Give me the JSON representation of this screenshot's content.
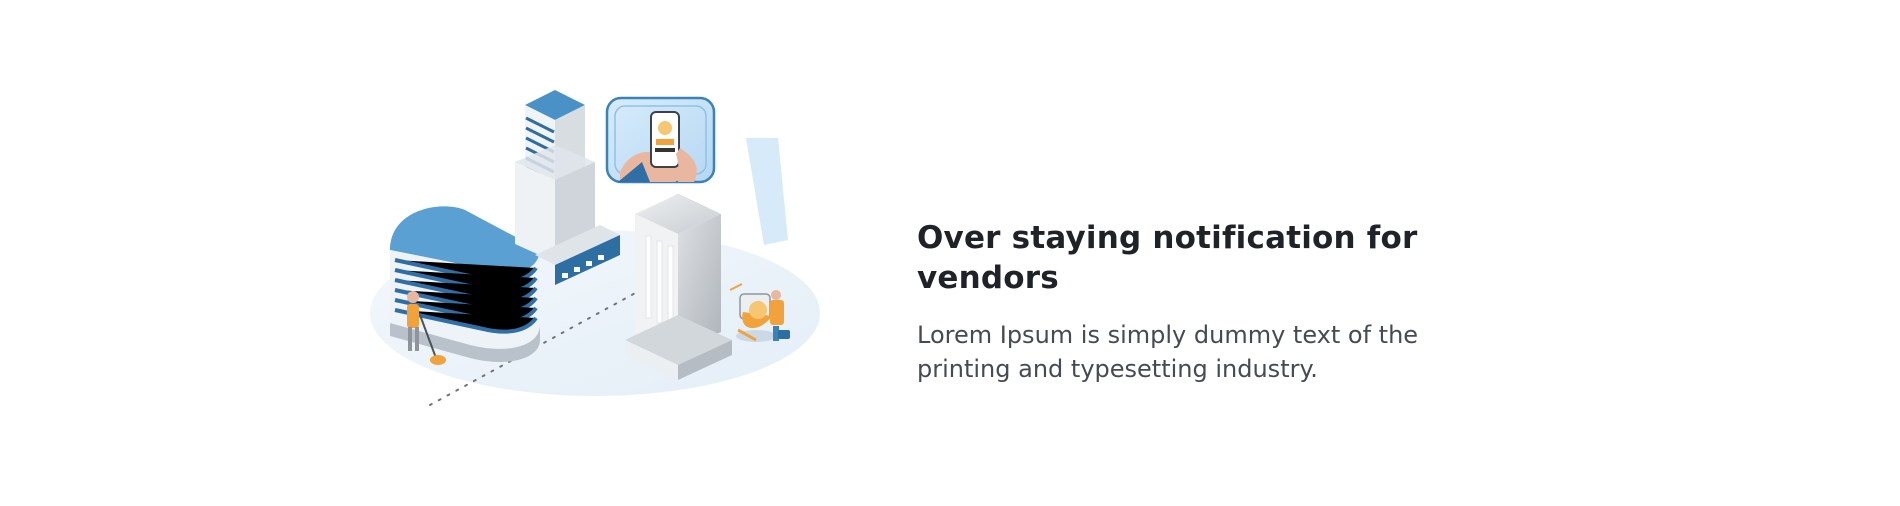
{
  "feature": {
    "title": "Over staying notification for vendors",
    "description": "Lorem Ipsum is simply dummy text of the printing and typesetting industry."
  },
  "illustration": {
    "name": "isometric-city-notification-illustration",
    "icons": [
      "office-buildings-icon",
      "phone-notification-icon",
      "vendor-worker-icon",
      "street-cleaner-icon"
    ],
    "colors": {
      "blue_light": "#d9ebf7",
      "blue": "#3b82b8",
      "blue_dark": "#1f5f8f",
      "gray": "#c5c8cc",
      "gray_dark": "#8f959b",
      "orange": "#f2a23a",
      "skin": "#e9b79f",
      "ground": "#edf4fa"
    }
  }
}
